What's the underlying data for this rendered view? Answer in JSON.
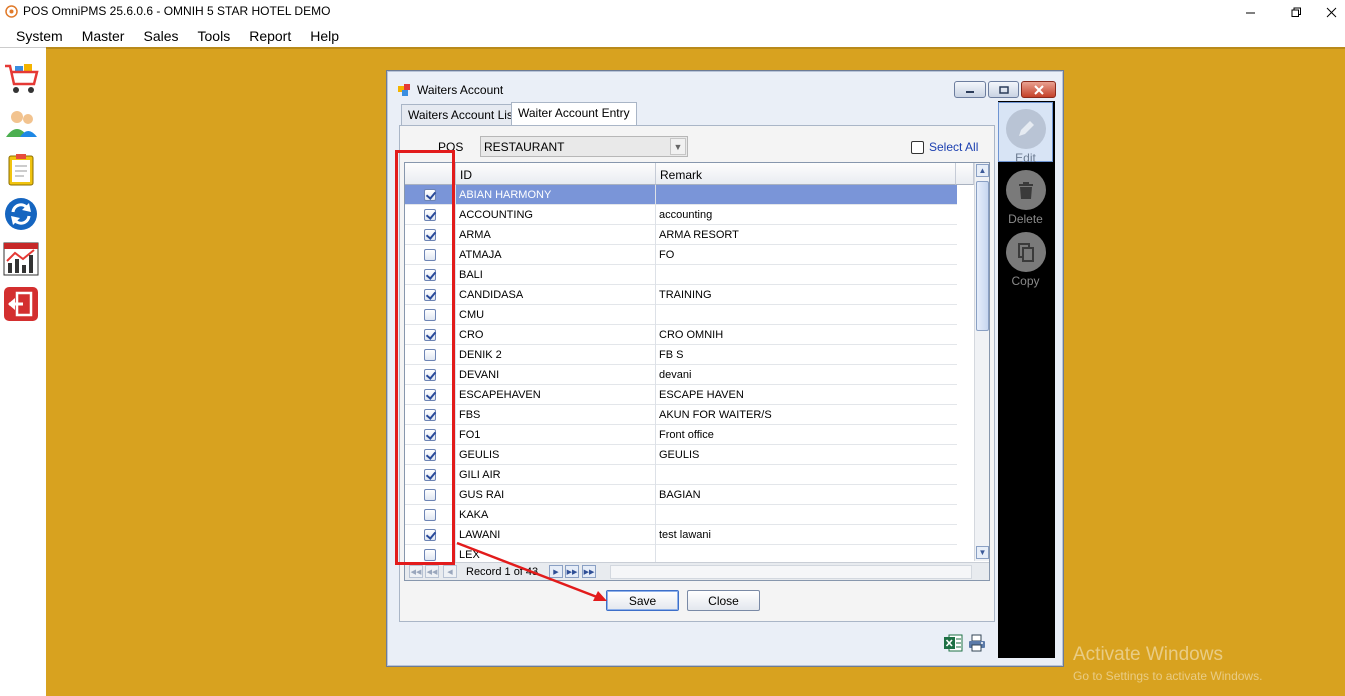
{
  "window": {
    "title": "POS OmniPMS 25.6.0.6 - OMNIH 5 STAR HOTEL DEMO"
  },
  "menu": [
    "System",
    "Master",
    "Sales",
    "Tools",
    "Report",
    "Help"
  ],
  "left_toolbar": [
    "cart-icon",
    "users-icon",
    "clipboard-icon",
    "refresh-icon",
    "report-chart-icon",
    "exit-icon"
  ],
  "dialog": {
    "title": "Waiters Account",
    "tabs": [
      "Waiters Account List",
      "Waiter Account Entry"
    ],
    "pos_label": "POS",
    "pos_value": "RESTAURANT",
    "select_all_label": "Select All",
    "grid": {
      "columns": [
        "ID",
        "Remark"
      ],
      "rows": [
        {
          "id": "ABIAN HARMONY",
          "remark": "",
          "checked": true
        },
        {
          "id": "ACCOUNTING",
          "remark": "accounting",
          "checked": true
        },
        {
          "id": "ARMA",
          "remark": "ARMA RESORT",
          "checked": true
        },
        {
          "id": "ATMAJA",
          "remark": "FO",
          "checked": false
        },
        {
          "id": "BALI",
          "remark": "",
          "checked": true
        },
        {
          "id": "CANDIDASA",
          "remark": "TRAINING",
          "checked": true
        },
        {
          "id": "CMU",
          "remark": "",
          "checked": false
        },
        {
          "id": "CRO",
          "remark": "CRO OMNIH",
          "checked": true
        },
        {
          "id": "DENIK 2",
          "remark": "FB S",
          "checked": false
        },
        {
          "id": "DEVANI",
          "remark": "devani",
          "checked": true
        },
        {
          "id": "ESCAPEHAVEN",
          "remark": "ESCAPE HAVEN",
          "checked": true
        },
        {
          "id": "FBS",
          "remark": "AKUN FOR WAITER/S",
          "checked": true
        },
        {
          "id": "FO1",
          "remark": "Front office",
          "checked": true
        },
        {
          "id": "GEULIS",
          "remark": "GEULIS",
          "checked": true
        },
        {
          "id": "GILI AIR",
          "remark": "",
          "checked": true
        },
        {
          "id": "GUS RAI",
          "remark": "BAGIAN",
          "checked": false
        },
        {
          "id": "KAKA",
          "remark": "",
          "checked": false
        },
        {
          "id": "LAWANI",
          "remark": "test lawani",
          "checked": true
        },
        {
          "id": "LEX",
          "remark": "",
          "checked": false
        }
      ],
      "record_text": "Record 1 of 43"
    },
    "save_label": "Save",
    "close_label": "Close"
  },
  "actions": [
    {
      "label": "Edit",
      "icon": "edit-icon",
      "active": true
    },
    {
      "label": "Delete",
      "icon": "trash-icon",
      "active": false
    },
    {
      "label": "Copy",
      "icon": "copy-icon",
      "active": false
    }
  ],
  "watermark": {
    "line1": "Activate Windows",
    "line2": "Go to Settings to activate Windows."
  },
  "colors": {
    "workspace": "#d8a21f",
    "selected_row": "#7a95d8",
    "annotation": "#e21b1b"
  }
}
